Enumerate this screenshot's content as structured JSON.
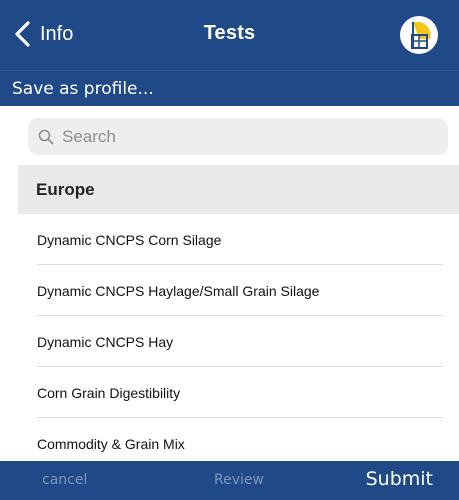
{
  "navbar": {
    "back_label": "Info",
    "title": "Tests",
    "icons": {
      "back": "chevron-left-icon",
      "logo": "app-logo-icon"
    },
    "color": "#1f4a87"
  },
  "profile_bar": {
    "label": "Save as profile..."
  },
  "search": {
    "placeholder": "Search",
    "value": "",
    "icon": "search-icon"
  },
  "section": {
    "header": "Europe"
  },
  "tests": [
    {
      "label": "Dynamic CNCPS Corn Silage"
    },
    {
      "label": "Dynamic CNCPS Haylage/Small Grain Silage"
    },
    {
      "label": "Dynamic CNCPS Hay"
    },
    {
      "label": "Corn Grain Digestibility"
    },
    {
      "label": "Commodity & Grain Mix"
    }
  ],
  "toolbar": {
    "cancel_label": "cancel",
    "review_label": "Review",
    "submit_label": "Submit"
  },
  "colors": {
    "accent": "#1f4a87",
    "logo_yellow": "#f4c51b",
    "disabled_text": "#7f97bd"
  }
}
